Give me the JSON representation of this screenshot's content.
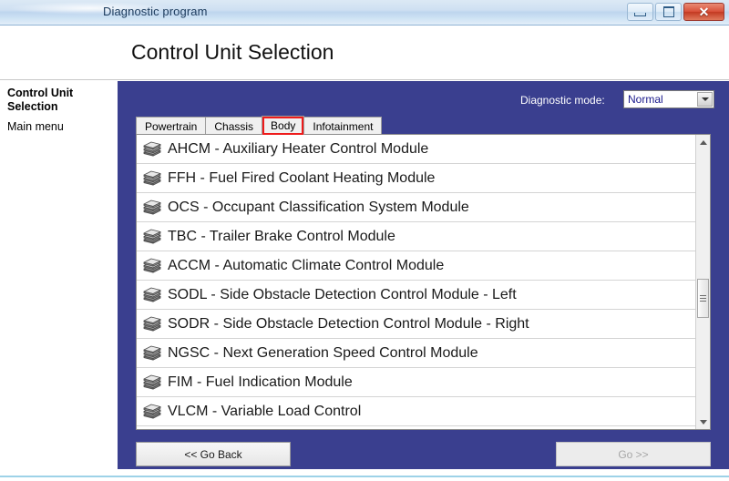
{
  "window": {
    "title": "Diagnostic program",
    "minimize_label": "Minimize",
    "maximize_label": "Maximize",
    "close_label": "✕"
  },
  "header": {
    "page_title": "Control Unit Selection"
  },
  "sidebar": {
    "title": "Control Unit Selection",
    "items": [
      {
        "label": "Main menu"
      }
    ]
  },
  "toolbar": {
    "mode_label": "Diagnostic mode:",
    "mode_value": "Normal",
    "mode_options": [
      "Normal"
    ]
  },
  "tabs": [
    {
      "label": "Powertrain",
      "active": false
    },
    {
      "label": "Chassis",
      "active": false
    },
    {
      "label": "Body",
      "active": true
    },
    {
      "label": "Infotainment",
      "active": false
    }
  ],
  "list": {
    "icon": "module-stack-icon",
    "items": [
      {
        "label": "AHCM - Auxiliary Heater Control Module"
      },
      {
        "label": "FFH - Fuel Fired Coolant Heating Module"
      },
      {
        "label": "OCS - Occupant Classification System Module"
      },
      {
        "label": "TBC - Trailer Brake Control Module"
      },
      {
        "label": "ACCM - Automatic Climate Control Module"
      },
      {
        "label": "SODL - Side Obstacle Detection Control Module - Left"
      },
      {
        "label": "SODR - Side Obstacle Detection Control Module - Right"
      },
      {
        "label": "NGSC - Next Generation Speed Control Module"
      },
      {
        "label": "FIM - Fuel Indication Module"
      },
      {
        "label": "VLCM - Variable Load Control"
      }
    ]
  },
  "footer": {
    "back_label": "<< Go Back",
    "go_label": "Go >>",
    "go_disabled": true
  },
  "colors": {
    "panel_blue": "#3a3f8f",
    "tab_highlight_red": "#ee1b1b",
    "select_text_blue": "#1a1a8c",
    "titlebar_text": "#1b3a5c"
  }
}
